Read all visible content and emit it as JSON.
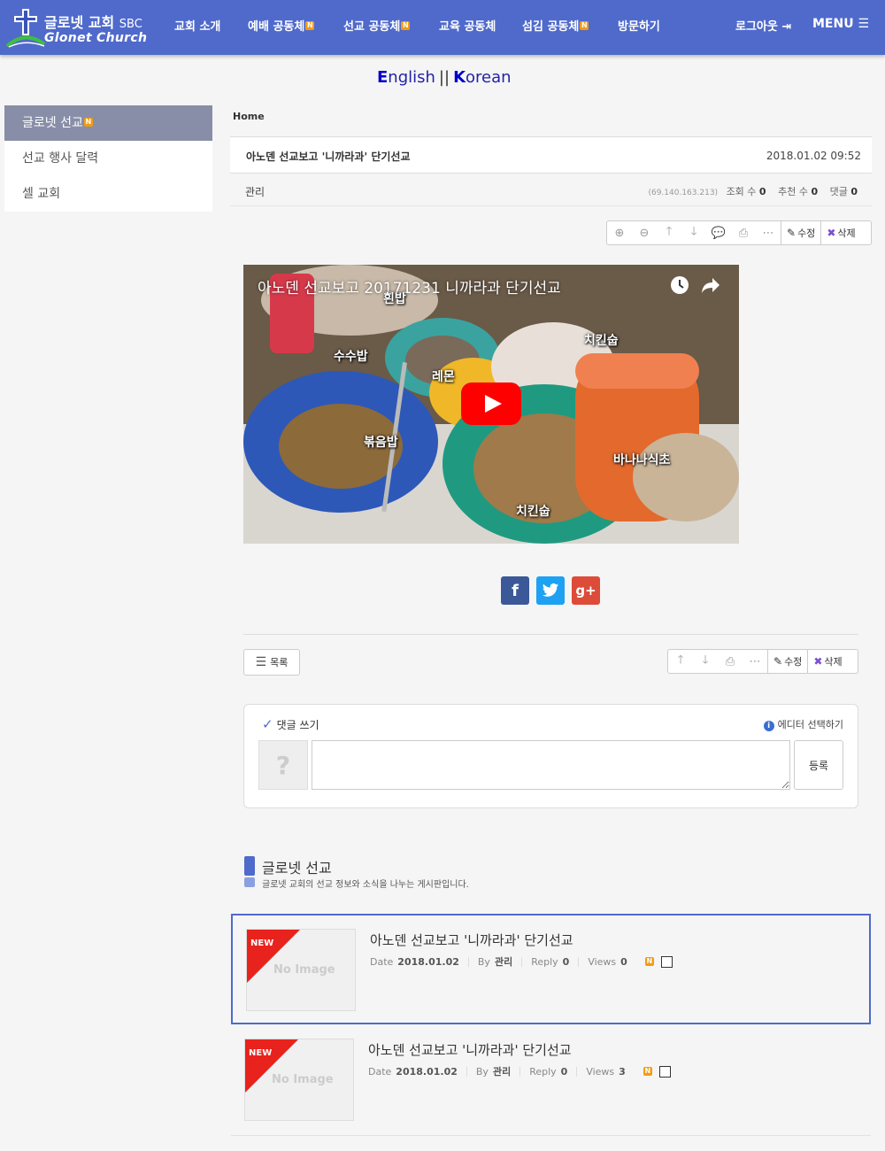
{
  "header": {
    "logo_kr": "글로넷 교회",
    "logo_sbc": "SBC",
    "logo_en": "Glonet Church",
    "swoosh_text": "GLONET",
    "nav": [
      {
        "label": "교회 소개",
        "badge": ""
      },
      {
        "label": "예배 공동체",
        "badge": "N"
      },
      {
        "label": "선교 공동체",
        "badge": "N"
      },
      {
        "label": "교육 공동체",
        "badge": ""
      },
      {
        "label": "섬김 공동체",
        "badge": "N"
      },
      {
        "label": "방문하기",
        "badge": ""
      }
    ],
    "logout": "로그아웃",
    "menu": "MENU"
  },
  "lang": {
    "english_first": "E",
    "english_rest": "nglish",
    "separator": "||",
    "korean_first": "K",
    "korean_rest": "orean"
  },
  "sidebar": {
    "items": [
      {
        "label": "글로넷 선교",
        "badge": "N"
      },
      {
        "label": "선교 행사 달력"
      },
      {
        "label": "셀 교회"
      }
    ]
  },
  "breadcrumb": "Home",
  "post": {
    "title": "아노덴 선교보고 '니까라과' 단기선교",
    "date": "2018.01.02 09:52",
    "author": "관리",
    "ip": "(69.140.163.213)",
    "views_label": "조회 수",
    "views": "0",
    "recommend_label": "추천 수",
    "recommend": "0",
    "comments_label": "댓글",
    "comments": "0"
  },
  "toolbar": {
    "edit": "수정",
    "delete": "삭제"
  },
  "video": {
    "title": "아노덴 선교보고 20171231 니까라과 단기선교",
    "labels": [
      "흰밥",
      "수수밥",
      "레몬",
      "치킨숩",
      "볶음밥",
      "바나나식초",
      "치킨숩"
    ]
  },
  "share": {
    "facebook": "f",
    "twitter": "t",
    "google": "g+"
  },
  "bottom": {
    "list_label": "목록"
  },
  "comment": {
    "title": "댓글 쓰기",
    "editor_select": "에디터 선택하기",
    "avatar": "?",
    "submit": "등록"
  },
  "board": {
    "title": "글로넷 선교",
    "description": "글로넷 교회의 선교 정보와 소식을 나누는 게시판입니다.",
    "items": [
      {
        "new_label": "NEW",
        "no_image": "No Image",
        "title": "아노덴 선교보고 '니까라과' 단기선교",
        "date_label": "Date",
        "date": "2018.01.02",
        "by_label": "By",
        "author": "관리",
        "reply_label": "Reply",
        "reply": "0",
        "views_label": "Views",
        "views": "0",
        "badge": "N"
      },
      {
        "new_label": "NEW",
        "no_image": "No Image",
        "title": "아노덴 선교보고 '니까라과' 단기선교",
        "date_label": "Date",
        "date": "2018.01.02",
        "by_label": "By",
        "author": "관리",
        "reply_label": "Reply",
        "reply": "0",
        "views_label": "Views",
        "views": "3",
        "badge": "N"
      }
    ]
  },
  "colors": {
    "header_bg": "#4f6acb",
    "sidebar_active": "#888ea7",
    "new_ribbon": "#e8221c",
    "badge": "#f39c12",
    "facebook": "#3b5998",
    "twitter": "#1da1f2",
    "google": "#dd4b39"
  }
}
